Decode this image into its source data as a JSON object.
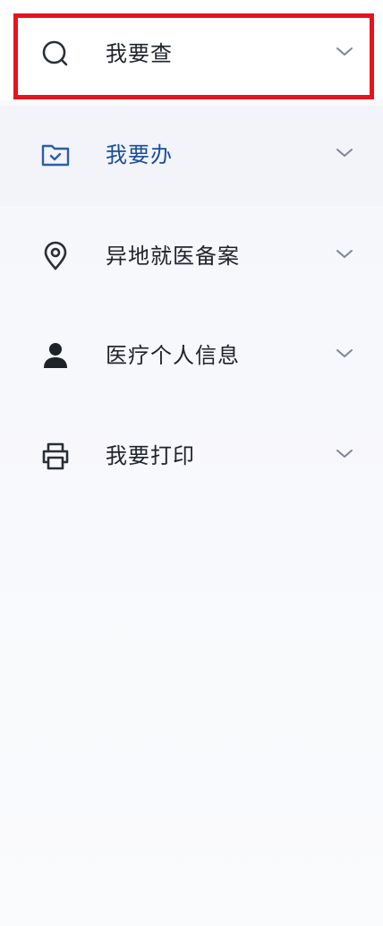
{
  "menu": {
    "items": [
      {
        "label": "我要查",
        "icon": "search-icon",
        "state": "highlighted"
      },
      {
        "label": "我要办",
        "icon": "folder-check-icon",
        "state": "active"
      },
      {
        "label": "异地就医备案",
        "icon": "location-pin-icon",
        "state": "normal"
      },
      {
        "label": "医疗个人信息",
        "icon": "person-icon",
        "state": "normal"
      },
      {
        "label": "我要打印",
        "icon": "printer-icon",
        "state": "normal"
      }
    ]
  },
  "colors": {
    "highlight_border": "#e5141e",
    "active_text": "#1a4d9c",
    "active_icon": "#2b5ea7",
    "normal_text": "#1f232b",
    "chevron": "#7f8694"
  }
}
